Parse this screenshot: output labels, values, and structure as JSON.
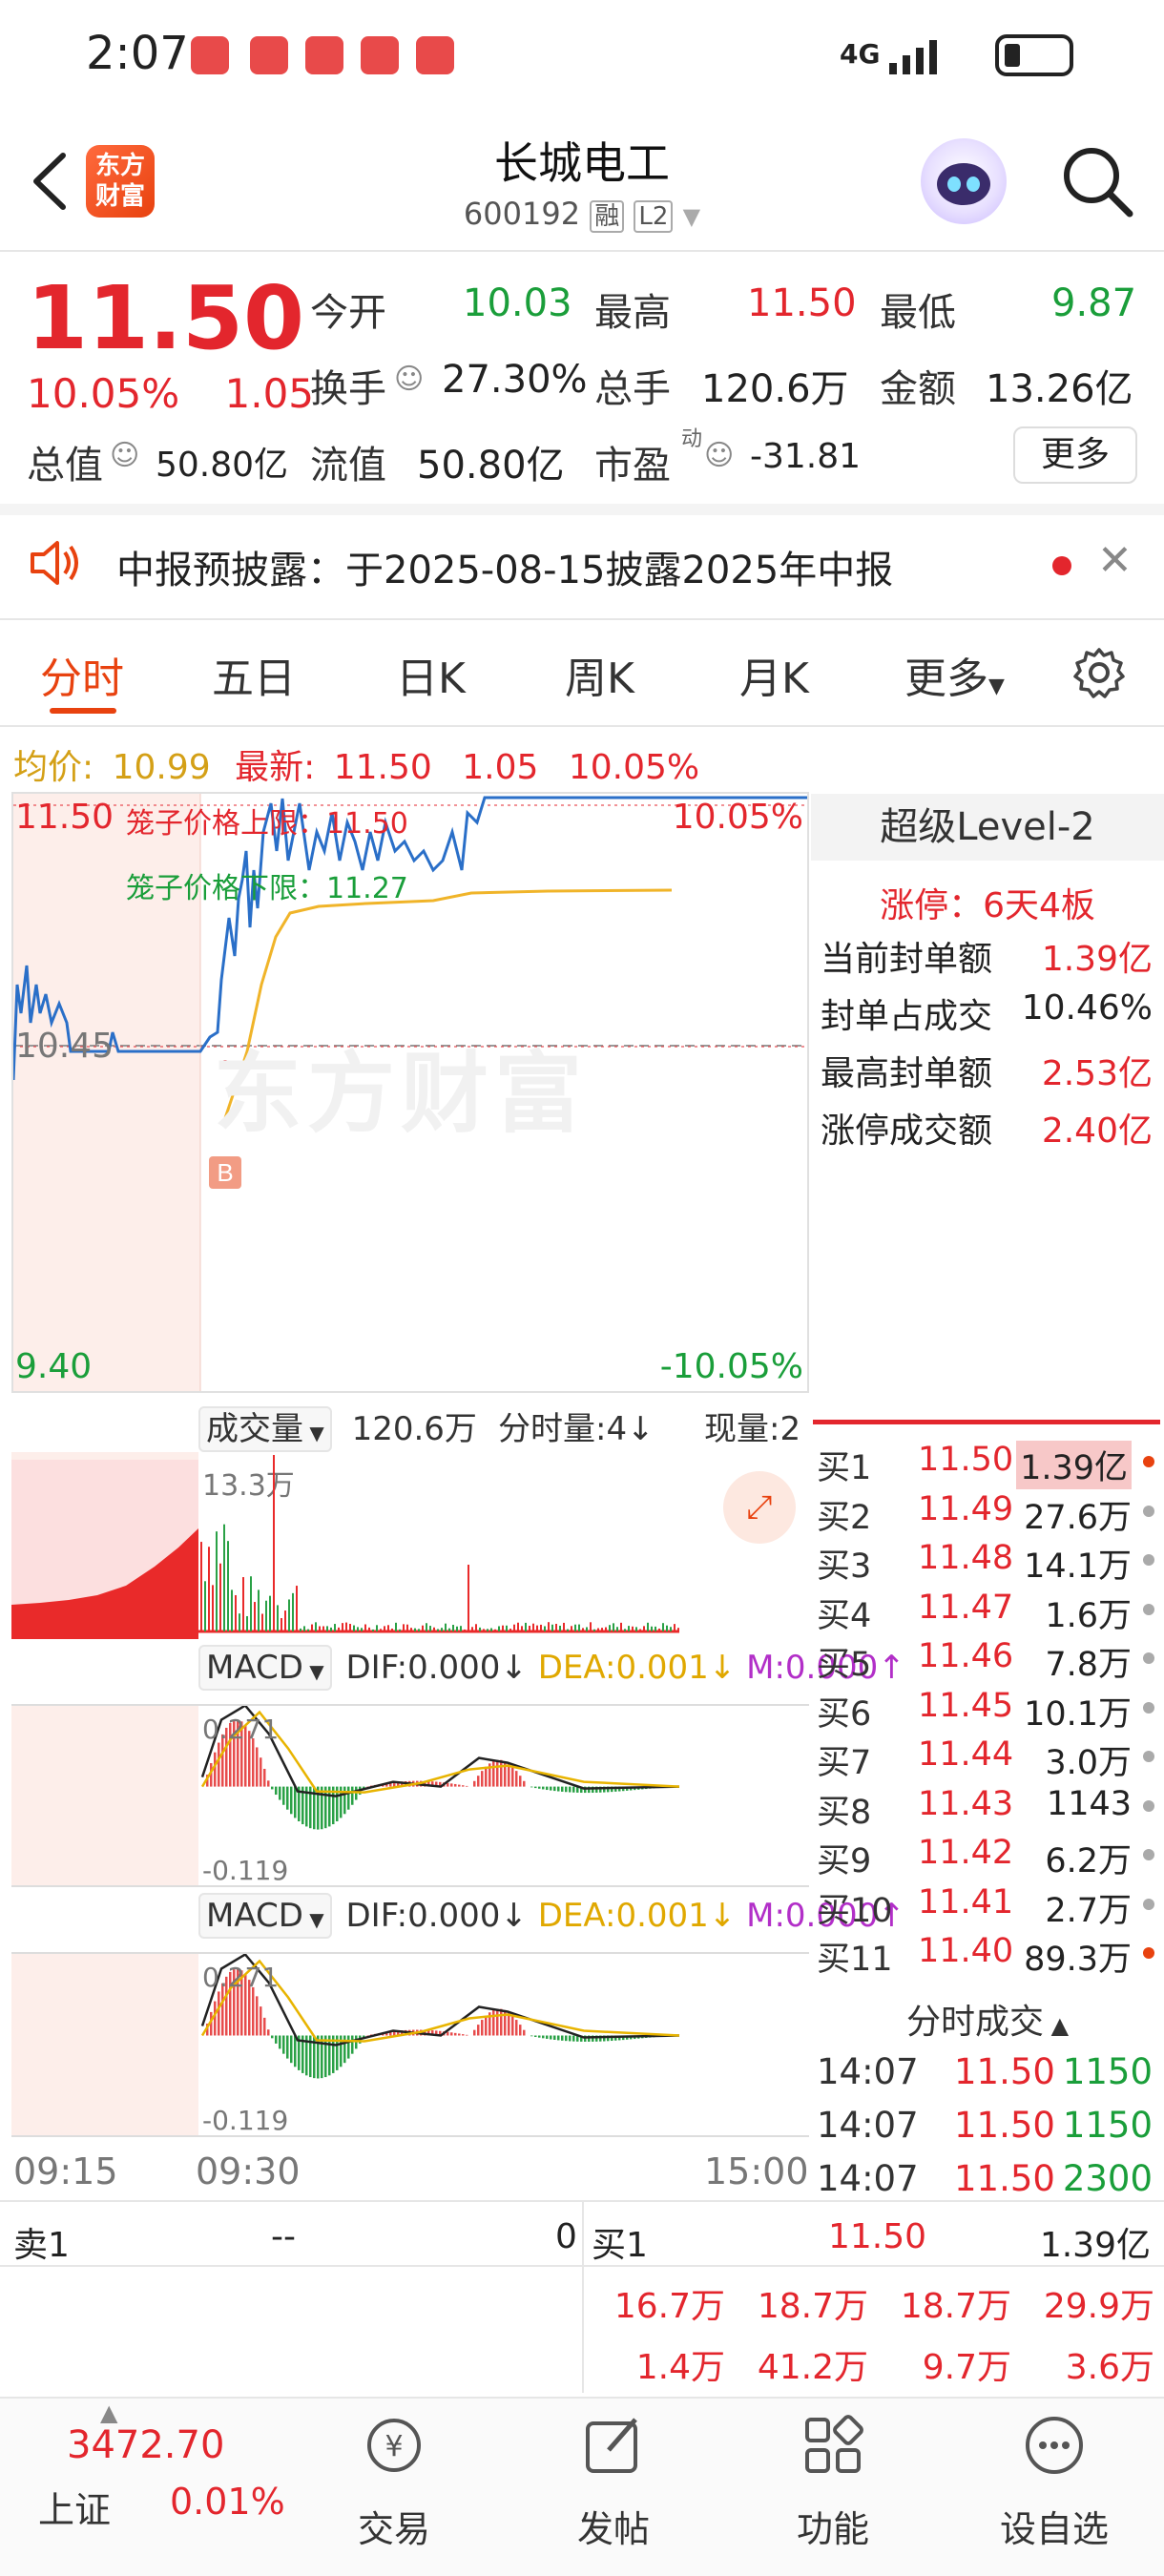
{
  "status_bar": {
    "time": "2:07",
    "network": "4G"
  },
  "header": {
    "back_icon": "chevron-left-icon",
    "logo_line1": "东方",
    "logo_line2": "财富",
    "title": "长城电工",
    "code": "600192",
    "tag_rong": "融",
    "tag_level": "L2"
  },
  "quote": {
    "price": "11.50",
    "change_pct": "10.05%",
    "change_amt": "1.05",
    "open_label": "今开",
    "open": "10.03",
    "high_label": "最高",
    "high": "11.50",
    "low_label": "最低",
    "low": "9.87",
    "turnover_label": "换手",
    "turnover": "27.30%",
    "volume_label": "总手",
    "volume": "120.6万",
    "amount_label": "金额",
    "amount": "13.26亿",
    "mktcap_label": "总值",
    "mktcap": "50.80亿",
    "float_label": "流值",
    "float": "50.80亿",
    "pe_label": "市盈",
    "pe_sup": "动",
    "pe": "-31.81",
    "more": "更多"
  },
  "notice": {
    "text": "中报预披露：于2025-08-15披露2025年中报"
  },
  "tabs": [
    "分时",
    "五日",
    "日K",
    "周K",
    "月K",
    "更多"
  ],
  "avg_line": {
    "avg_label": "均价:",
    "avg": "10.99",
    "latest_label": "最新:",
    "latest": "11.50",
    "chg": "1.05",
    "pct": "10.05%"
  },
  "chart": {
    "y_top": "11.50",
    "y_mid": "10.45",
    "y_bottom": "9.40",
    "pct_top": "10.05%",
    "pct_bottom": "-10.05%",
    "cage_upper": "笼子价格上限：11.50",
    "cage_lower": "笼子价格下限：11.27",
    "watermark": "东方财富",
    "buy_marker": "B",
    "vol_label": "成交量",
    "vol_total": "120.6万",
    "vol_period": "分时量:4↓",
    "vol_now": "现量:2",
    "vol_max": "13.3万",
    "macd1": {
      "label": "MACD",
      "dif": "DIF:0.000↓",
      "dea": "DEA:0.001↓",
      "m": "M:0.000↑",
      "top": "0.271",
      "bottom": "-0.119"
    },
    "macd2": {
      "label": "MACD",
      "dif": "DIF:0.000↓",
      "dea": "DEA:0.001↓",
      "m": "M:0.000↑",
      "top": "0.271",
      "bottom": "-0.119"
    },
    "time_start": "09:15",
    "time_open": "09:30",
    "time_end": "15:00"
  },
  "level2": {
    "title": "超级Level-2",
    "limit_up": "涨停：6天4板",
    "rows": [
      {
        "label": "当前封单额",
        "value": "1.39亿"
      },
      {
        "label": "封单占成交",
        "value": "10.46%"
      },
      {
        "label": "最高封单额",
        "value": "2.53亿"
      },
      {
        "label": "涨停成交额",
        "value": "2.40亿"
      }
    ]
  },
  "bids": [
    {
      "label": "买1",
      "price": "11.50",
      "vol": "1.39亿"
    },
    {
      "label": "买2",
      "price": "11.49",
      "vol": "27.6万"
    },
    {
      "label": "买3",
      "price": "11.48",
      "vol": "14.1万"
    },
    {
      "label": "买4",
      "price": "11.47",
      "vol": "1.6万"
    },
    {
      "label": "买5",
      "price": "11.46",
      "vol": "7.8万"
    },
    {
      "label": "买6",
      "price": "11.45",
      "vol": "10.1万"
    },
    {
      "label": "买7",
      "price": "11.44",
      "vol": "3.0万"
    },
    {
      "label": "买8",
      "price": "11.43",
      "vol": "1143"
    },
    {
      "label": "买9",
      "price": "11.42",
      "vol": "6.2万"
    },
    {
      "label": "买10",
      "price": "11.41",
      "vol": "2.7万"
    },
    {
      "label": "买11",
      "price": "11.40",
      "vol": "89.3万"
    }
  ],
  "ticks": {
    "title": "分时成交",
    "rows": [
      {
        "time": "14:07",
        "price": "11.50",
        "vol": "1150"
      },
      {
        "time": "14:07",
        "price": "11.50",
        "vol": "1150"
      },
      {
        "time": "14:07",
        "price": "11.50",
        "vol": "2300"
      }
    ]
  },
  "bottom_quote": {
    "sell1_label": "卖1",
    "sell1_price": "--",
    "sell1_vol": "0",
    "buy1_label": "买1",
    "buy1_price": "11.50",
    "buy1_vol": "1.39亿",
    "row1": [
      "16.7万",
      "18.7万",
      "18.7万",
      "29.9万"
    ],
    "row2": [
      "1.4万",
      "41.2万",
      "9.7万",
      "3.6万"
    ]
  },
  "nav": {
    "index_value": "3472.70",
    "index_name": "上证",
    "index_pct": "0.01%",
    "items": [
      "交易",
      "发帖",
      "功能",
      "设自选"
    ]
  }
}
